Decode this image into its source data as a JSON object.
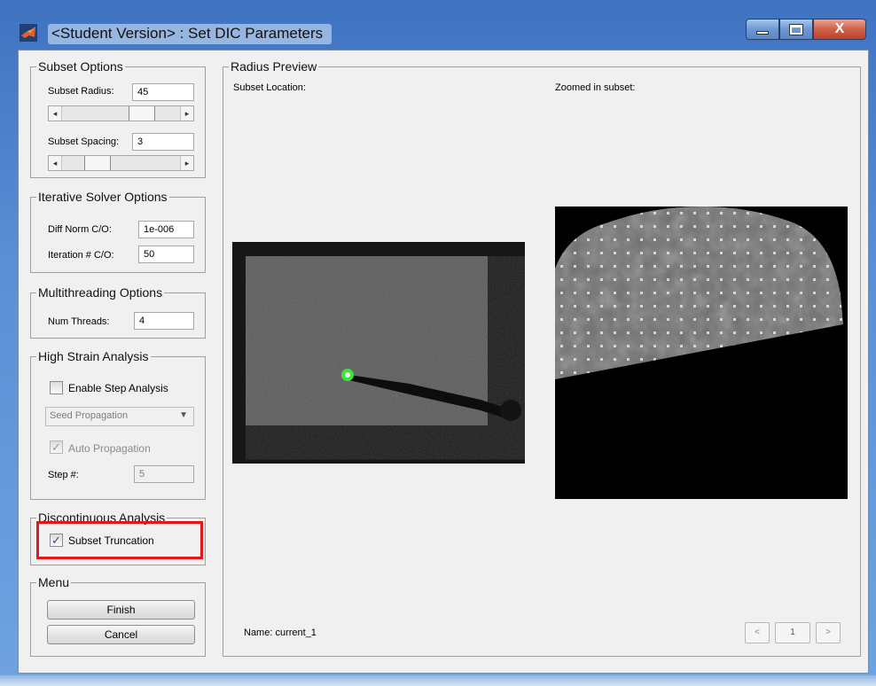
{
  "window": {
    "title": "<Student Version> : Set DIC Parameters",
    "close_glyph": "X",
    "icons": {
      "app": "matlab-icon",
      "minimize": "minimize-icon",
      "maximize": "maximize-icon",
      "close": "close-icon"
    }
  },
  "subset_options": {
    "title": "Subset Options",
    "radius_label": "Subset Radius:",
    "radius_value": "45",
    "radius_slider_fraction": 0.72,
    "spacing_label": "Subset Spacing:",
    "spacing_value": "3",
    "spacing_slider_fraction": 0.25,
    "arrow_left": "◂",
    "arrow_right": "▸"
  },
  "iterative_solver": {
    "title": "Iterative Solver Options",
    "diff_norm_label": "Diff Norm C/O:",
    "diff_norm_value": "1e-006",
    "iteration_label": "Iteration # C/O:",
    "iteration_value": "50"
  },
  "multithreading": {
    "title": "Multithreading Options",
    "threads_label": "Num Threads:",
    "threads_value": "4"
  },
  "high_strain": {
    "title": "High Strain Analysis",
    "enable_step_label": "Enable Step Analysis",
    "enable_step_checked": false,
    "propagation_selected": "Seed Propagation",
    "auto_propagation_label": "Auto Propagation",
    "auto_propagation_checked": true,
    "step_label": "Step #:",
    "step_value": "5",
    "check_glyph": "✓",
    "caret_glyph": "▼"
  },
  "discontinuous": {
    "title": "Discontinuous Analysis",
    "truncation_label": "Subset Truncation",
    "truncation_checked": true,
    "highlight_color": "#e3161b"
  },
  "menu": {
    "title": "Menu",
    "finish_label": "Finish",
    "cancel_label": "Cancel"
  },
  "preview": {
    "title": "Radius Preview",
    "subset_location_label": "Subset Location:",
    "zoomed_label": "Zoomed in subset:",
    "name_text": "Name: current_1",
    "prev_label": "<",
    "page_value": "1",
    "next_label": ">",
    "seed_color": "#3fe03f"
  }
}
